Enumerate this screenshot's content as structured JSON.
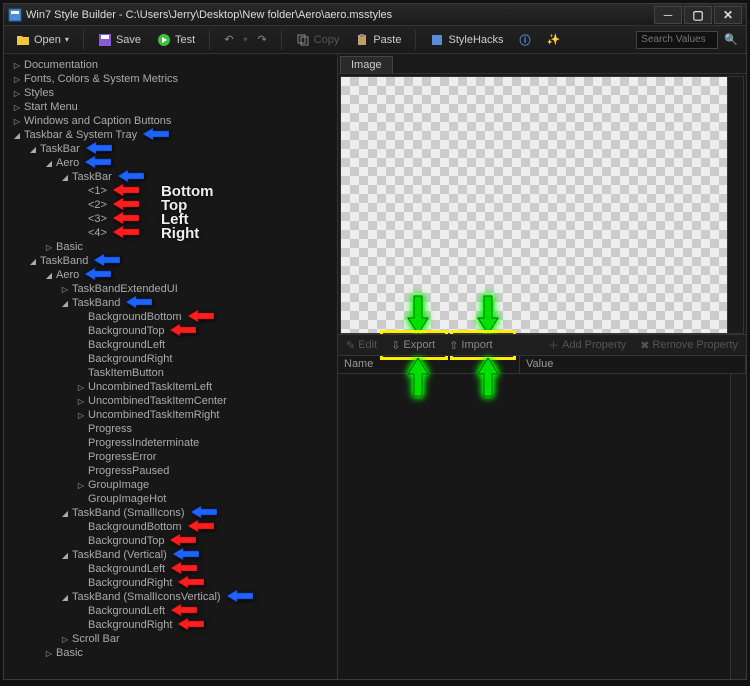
{
  "window": {
    "title": "Win7 Style Builder - C:\\Users\\Jerry\\Desktop\\New folder\\Aero\\aero.msstyles"
  },
  "toolbar": {
    "open": "Open",
    "save": "Save",
    "test": "Test",
    "copy": "Copy",
    "paste": "Paste",
    "stylehacks": "StyleHacks",
    "search_placeholder": "Search Values"
  },
  "tree": {
    "items": [
      {
        "depth": 0,
        "exp": "▷",
        "label": "Documentation"
      },
      {
        "depth": 0,
        "exp": "▷",
        "label": "Fonts, Colors & System Metrics"
      },
      {
        "depth": 0,
        "exp": "▷",
        "label": "Styles"
      },
      {
        "depth": 0,
        "exp": "▷",
        "label": "Start Menu"
      },
      {
        "depth": 0,
        "exp": "▷",
        "label": "Windows and Caption Buttons"
      },
      {
        "depth": 0,
        "exp": "◢",
        "label": "Taskbar & System Tray",
        "arrow": "blue"
      },
      {
        "depth": 1,
        "exp": "◢",
        "label": "TaskBar",
        "arrow": "blue"
      },
      {
        "depth": 2,
        "exp": "◢",
        "label": "Aero",
        "arrow": "blue"
      },
      {
        "depth": 3,
        "exp": "◢",
        "label": "TaskBar",
        "arrow": "blue"
      },
      {
        "depth": 4,
        "exp": "",
        "label": "<1>",
        "arrow": "red",
        "annot": "Bottom"
      },
      {
        "depth": 4,
        "exp": "",
        "label": "<2>",
        "arrow": "red",
        "annot": "Top"
      },
      {
        "depth": 4,
        "exp": "",
        "label": "<3>",
        "arrow": "red",
        "annot": "Left"
      },
      {
        "depth": 4,
        "exp": "",
        "label": "<4>",
        "arrow": "red",
        "annot": "Right"
      },
      {
        "depth": 2,
        "exp": "▷",
        "label": "Basic"
      },
      {
        "depth": 1,
        "exp": "◢",
        "label": "TaskBand",
        "arrow": "blue"
      },
      {
        "depth": 2,
        "exp": "◢",
        "label": "Aero",
        "arrow": "blue"
      },
      {
        "depth": 3,
        "exp": "▷",
        "label": "TaskBandExtendedUI"
      },
      {
        "depth": 3,
        "exp": "◢",
        "label": "TaskBand",
        "arrow": "blue"
      },
      {
        "depth": 4,
        "exp": "",
        "label": "BackgroundBottom",
        "arrow": "red"
      },
      {
        "depth": 4,
        "exp": "",
        "label": "BackgroundTop",
        "arrow": "red"
      },
      {
        "depth": 4,
        "exp": "",
        "label": "BackgroundLeft"
      },
      {
        "depth": 4,
        "exp": "",
        "label": "BackgroundRight"
      },
      {
        "depth": 4,
        "exp": "",
        "label": "TaskItemButton"
      },
      {
        "depth": 4,
        "exp": "▷",
        "label": "UncombinedTaskItemLeft"
      },
      {
        "depth": 4,
        "exp": "▷",
        "label": "UncombinedTaskItemCenter"
      },
      {
        "depth": 4,
        "exp": "▷",
        "label": "UncombinedTaskItemRight"
      },
      {
        "depth": 4,
        "exp": "",
        "label": "Progress"
      },
      {
        "depth": 4,
        "exp": "",
        "label": "ProgressIndeterminate"
      },
      {
        "depth": 4,
        "exp": "",
        "label": "ProgressError"
      },
      {
        "depth": 4,
        "exp": "",
        "label": "ProgressPaused"
      },
      {
        "depth": 4,
        "exp": "▷",
        "label": "GroupImage"
      },
      {
        "depth": 4,
        "exp": "",
        "label": "GroupImageHot"
      },
      {
        "depth": 3,
        "exp": "◢",
        "label": "TaskBand (SmallIcons)",
        "arrow": "blue"
      },
      {
        "depth": 4,
        "exp": "",
        "label": "BackgroundBottom",
        "arrow": "red"
      },
      {
        "depth": 4,
        "exp": "",
        "label": "BackgroundTop",
        "arrow": "red"
      },
      {
        "depth": 3,
        "exp": "◢",
        "label": "TaskBand (Vertical)",
        "arrow": "blue"
      },
      {
        "depth": 4,
        "exp": "",
        "label": "BackgroundLeft",
        "arrow": "red"
      },
      {
        "depth": 4,
        "exp": "",
        "label": "BackgroundRight",
        "arrow": "red"
      },
      {
        "depth": 3,
        "exp": "◢",
        "label": "TaskBand (SmallIconsVertical)",
        "arrow": "blue"
      },
      {
        "depth": 4,
        "exp": "",
        "label": "BackgroundLeft",
        "arrow": "red"
      },
      {
        "depth": 4,
        "exp": "",
        "label": "BackgroundRight",
        "arrow": "red"
      },
      {
        "depth": 3,
        "exp": "▷",
        "label": "Scroll Bar"
      },
      {
        "depth": 2,
        "exp": "▷",
        "label": "Basic"
      }
    ]
  },
  "right": {
    "tab": "Image",
    "actions": {
      "edit": "Edit",
      "export": "Export",
      "import": "Import",
      "add_property": "Add Property",
      "remove_property": "Remove Property"
    },
    "columns": {
      "name": "Name",
      "value": "Value"
    }
  }
}
